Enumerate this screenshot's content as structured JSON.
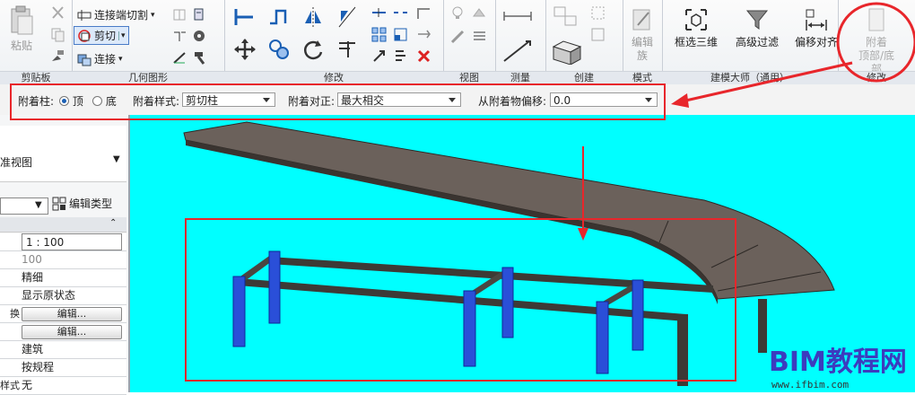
{
  "ribbon": {
    "clipboard": {
      "title": "剪贴板",
      "paste": "粘贴"
    },
    "geometry": {
      "title": "几何图形",
      "cut_join": "连接端切割",
      "cut": "剪切",
      "join": "连接"
    },
    "modify": {
      "title": "修改"
    },
    "view": {
      "title": "视图"
    },
    "measure": {
      "title": "测量"
    },
    "create": {
      "title": "创建"
    },
    "mode": {
      "title": "模式",
      "edit_family_1": "编辑",
      "edit_family_2": "族"
    },
    "model_tools": {
      "title": "建模大师（通用）",
      "box_3d": "框选三维",
      "adv_filter": "高级过滤",
      "offset_align": "偏移对齐"
    },
    "attach": {
      "title": "修改",
      "line1": "附着",
      "line2": "顶部/底部"
    }
  },
  "options_bar": {
    "attach_col_label": "附着柱:",
    "top_label": "顶",
    "bottom_label": "底",
    "style_label": "附着样式:",
    "style_value": "剪切柱",
    "justify_label": "附着对正:",
    "justify_value": "最大相交",
    "offset_label": "从附着物偏移:",
    "offset_value": "0.0"
  },
  "properties": {
    "view_name": "准视图",
    "edit_type": "编辑类型",
    "rows": [
      {
        "key": "",
        "value": "1 : 100"
      },
      {
        "key": "",
        "value": "100"
      },
      {
        "key": "",
        "value": "精细"
      },
      {
        "key": "",
        "value": "显示原状态"
      },
      {
        "key": "换",
        "value": "编辑..."
      },
      {
        "key": "",
        "value": "编辑..."
      },
      {
        "key": "",
        "value": "建筑"
      },
      {
        "key": "",
        "value": "按规程"
      },
      {
        "key": "样式",
        "value": "无"
      }
    ]
  },
  "watermark": {
    "brand": "BIM教程网",
    "url": "www.ifbim.com"
  },
  "colors": {
    "viewport_bg": "#00ffff",
    "highlight_red": "#e8262b",
    "column_blue": "#2a4fd8",
    "beam_dark": "#3d3a36"
  }
}
